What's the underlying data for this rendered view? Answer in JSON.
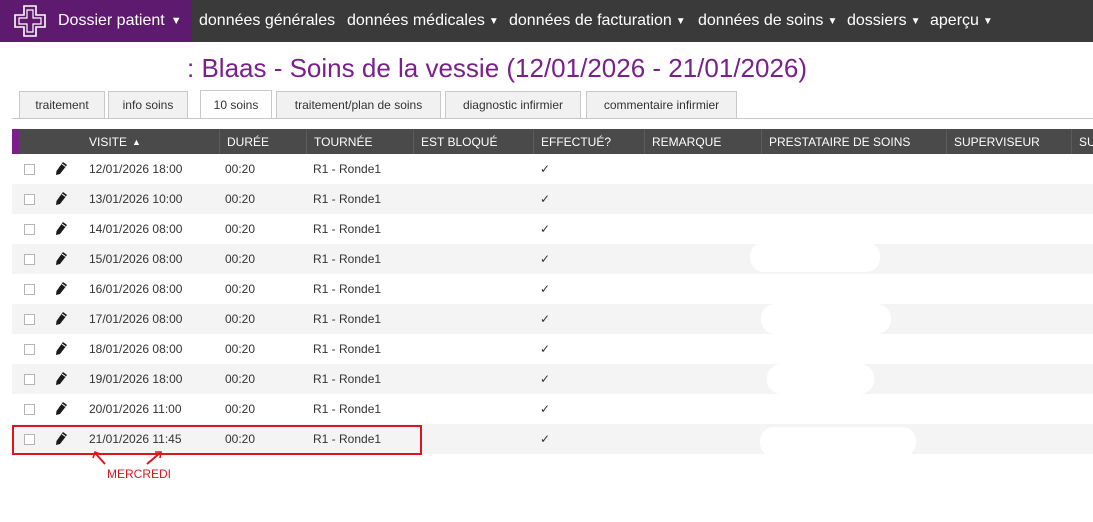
{
  "nav": {
    "brand_label": "Dossier patient",
    "items": [
      {
        "label": "données générales"
      },
      {
        "label": "données médicales"
      },
      {
        "label": "données de facturation"
      },
      {
        "label": "données de soins"
      },
      {
        "label": "dossiers"
      },
      {
        "label": "aperçu"
      }
    ]
  },
  "page": {
    "title": ": Blaas - Soins de la vessie (12/01/2026 - 21/01/2026)"
  },
  "tabs": [
    {
      "label": "traitement"
    },
    {
      "label": "info soins"
    },
    {
      "label": "10 soins",
      "active": true
    },
    {
      "label": "traitement/plan de soins"
    },
    {
      "label": "diagnostic infirmier"
    },
    {
      "label": "commentaire infirmier"
    }
  ],
  "table": {
    "columns": [
      "VISITE",
      "DURÉE",
      "TOURNÉE",
      "EST BLOQUÉ",
      "EFFECTUÉ?",
      "REMARQUE",
      "PRESTATAIRE DE SOINS",
      "SUPERVISEUR",
      "SU"
    ],
    "sort_indicator": "▲",
    "rows": [
      {
        "visite": "12/01/2026 18:00",
        "duree": "00:20",
        "tournee": "R1 - Ronde1",
        "effectue": "✓"
      },
      {
        "visite": "13/01/2026 10:00",
        "duree": "00:20",
        "tournee": "R1 - Ronde1",
        "effectue": "✓"
      },
      {
        "visite": "14/01/2026 08:00",
        "duree": "00:20",
        "tournee": "R1 - Ronde1",
        "effectue": "✓"
      },
      {
        "visite": "15/01/2026 08:00",
        "duree": "00:20",
        "tournee": "R1 - Ronde1",
        "effectue": "✓"
      },
      {
        "visite": "16/01/2026 08:00",
        "duree": "00:20",
        "tournee": "R1 - Ronde1",
        "effectue": "✓"
      },
      {
        "visite": "17/01/2026 08:00",
        "duree": "00:20",
        "tournee": "R1 - Ronde1",
        "effectue": "✓"
      },
      {
        "visite": "18/01/2026 08:00",
        "duree": "00:20",
        "tournee": "R1 - Ronde1",
        "effectue": "✓"
      },
      {
        "visite": "19/01/2026 18:00",
        "duree": "00:20",
        "tournee": "R1 - Ronde1",
        "effectue": "✓"
      },
      {
        "visite": "20/01/2026 11:00",
        "duree": "00:20",
        "tournee": "R1 - Ronde1",
        "effectue": "✓"
      },
      {
        "visite": "21/01/2026 11:45",
        "duree": "00:20",
        "tournee": "R1 - Ronde1",
        "effectue": "✓"
      }
    ]
  },
  "annotation": {
    "label": "MERCREDI"
  },
  "colors": {
    "brand": "#5e1a6e",
    "topbar": "#3a3a3a",
    "title": "#7a1f8c",
    "header": "#4a4a4a",
    "annotation": "#e0141e"
  }
}
